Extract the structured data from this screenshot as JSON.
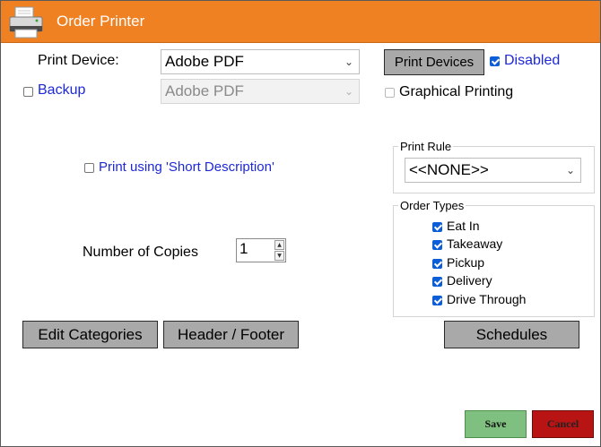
{
  "window": {
    "title": "Order Printer",
    "icon": "printer-icon"
  },
  "print_device": {
    "label": "Print Device:",
    "value": "Adobe PDF"
  },
  "print_devices_button": "Print Devices",
  "disabled_checkbox": {
    "label": "Disabled",
    "checked": true
  },
  "backup": {
    "label": "Backup",
    "checked": false,
    "device_value": "Adobe PDF"
  },
  "graphical_printing": {
    "label": "Graphical Printing",
    "checked": false
  },
  "short_description": {
    "label": "Print using 'Short Description'",
    "checked": false
  },
  "copies": {
    "label": "Number of Copies",
    "value": "1"
  },
  "print_rule": {
    "legend": "Print Rule",
    "value": "<<NONE>>"
  },
  "order_types": {
    "legend": "Order Types",
    "items": [
      {
        "label": "Eat In",
        "checked": true
      },
      {
        "label": "Takeaway",
        "checked": true
      },
      {
        "label": "Pickup",
        "checked": true
      },
      {
        "label": "Delivery",
        "checked": true
      },
      {
        "label": "Drive Through",
        "checked": true
      }
    ]
  },
  "buttons": {
    "edit_categories": "Edit Categories",
    "header_footer": "Header / Footer",
    "schedules": "Schedules",
    "save": "Save",
    "cancel": "Cancel"
  },
  "colors": {
    "titlebar": "#f08122",
    "link_blue": "#1d28d6",
    "save_green": "#7fbf7f",
    "cancel_red": "#b81414"
  }
}
